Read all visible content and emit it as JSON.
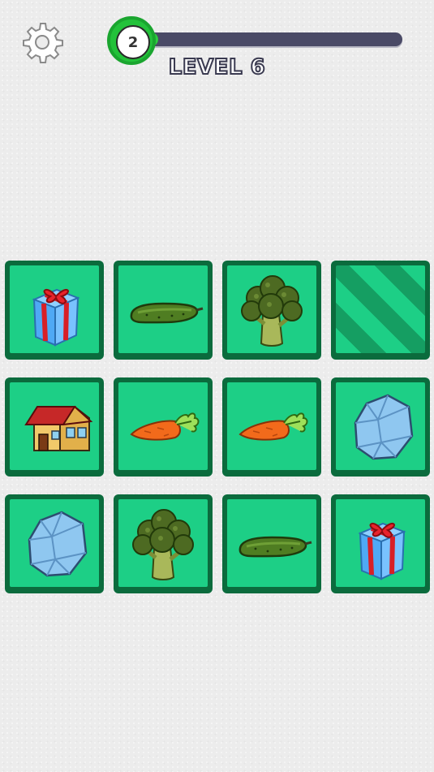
{
  "header": {
    "level_number": "2",
    "level_title": "LEVEL 6",
    "progress": 0.0
  },
  "icons": {
    "settings": "gear-icon"
  },
  "tiles": [
    {
      "item": "gift",
      "state": "revealed"
    },
    {
      "item": "cucumber",
      "state": "revealed"
    },
    {
      "item": "broccoli",
      "state": "revealed"
    },
    {
      "item": "",
      "state": "hidden"
    },
    {
      "item": "house",
      "state": "revealed"
    },
    {
      "item": "carrot",
      "state": "revealed"
    },
    {
      "item": "carrot",
      "state": "revealed"
    },
    {
      "item": "ice",
      "state": "revealed"
    },
    {
      "item": "ice",
      "state": "revealed"
    },
    {
      "item": "broccoli",
      "state": "revealed"
    },
    {
      "item": "cucumber",
      "state": "revealed"
    },
    {
      "item": "gift",
      "state": "revealed"
    }
  ],
  "colors": {
    "tile_face": "#1dcf86",
    "tile_border": "#0b6b3d",
    "progress_track": "#4a4a66",
    "badge_green": "#23c23a"
  }
}
